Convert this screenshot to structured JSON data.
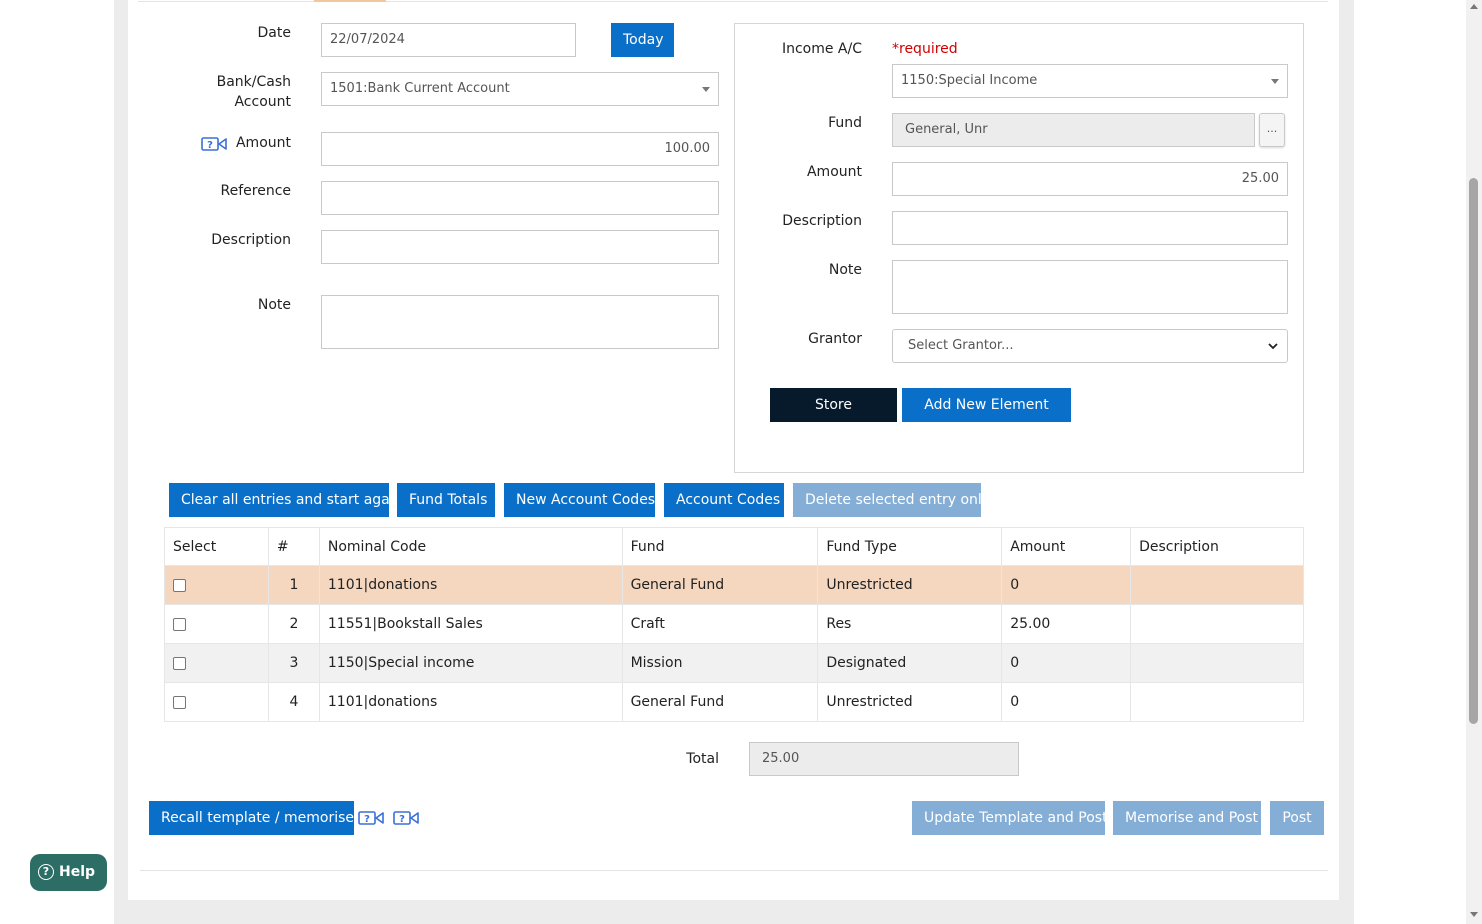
{
  "left_form": {
    "date_label": "Date",
    "date_value": "22/07/2024",
    "today_button": "Today",
    "bank_label_line1": "Bank/Cash",
    "bank_label_line2": "Account",
    "bank_value": "1501:Bank Current Account",
    "amount_label": "Amount",
    "amount_value": "100.00",
    "reference_label": "Reference",
    "reference_value": "",
    "description_label": "Description",
    "description_value": "",
    "note_label": "Note",
    "note_value": ""
  },
  "right_panel": {
    "income_label": "Income A/C",
    "required_text": "*required",
    "income_value": "1150:Special Income",
    "fund_label": "Fund",
    "fund_value": "General, Unr",
    "fund_picker_label": "...",
    "amount_label": "Amount",
    "amount_value": "25.00",
    "description_label": "Description",
    "description_value": "",
    "note_label": "Note",
    "note_value": "",
    "grantor_label": "Grantor",
    "grantor_placeholder": "Select Grantor...",
    "store_button": "Store",
    "add_new_button": "Add New Element"
  },
  "actions": {
    "clear_all": "Clear all entries and start again",
    "fund_totals": "Fund Totals",
    "new_account_codes": "New Account Codes",
    "account_codes": "Account Codes",
    "delete_selected": "Delete selected entry only"
  },
  "table": {
    "columns": [
      "Select",
      "#",
      "Nominal Code",
      "Fund",
      "Fund Type",
      "Amount",
      "Description"
    ],
    "rows": [
      {
        "num": "1",
        "code": "1101|donations",
        "fund": "General Fund",
        "fund_type": "Unrestricted",
        "amount": "0",
        "description": ""
      },
      {
        "num": "2",
        "code": "11551|Bookstall Sales",
        "fund": "Craft",
        "fund_type": "Res",
        "amount": "25.00",
        "description": ""
      },
      {
        "num": "3",
        "code": "1150|Special income",
        "fund": "Mission",
        "fund_type": "Designated",
        "amount": "0",
        "description": ""
      },
      {
        "num": "4",
        "code": "1101|donations",
        "fund": "General Fund",
        "fund_type": "Unrestricted",
        "amount": "0",
        "description": ""
      }
    ]
  },
  "totals": {
    "label": "Total",
    "value": "25.00"
  },
  "footer": {
    "recall_template": "Recall template / memorised",
    "update_template_post": "Update Template and Post",
    "memorise_post": "Memorise and Post",
    "post": "Post"
  },
  "help": {
    "label": "Help",
    "icon_glyph": "?"
  },
  "colors": {
    "primary_blue": "#0a6fc9",
    "disabled_blue": "#84aed6",
    "dark_button": "#061a2b",
    "highlight_row": "#f5d6be",
    "required_red": "#d00000",
    "help_green": "#2c6e66"
  }
}
